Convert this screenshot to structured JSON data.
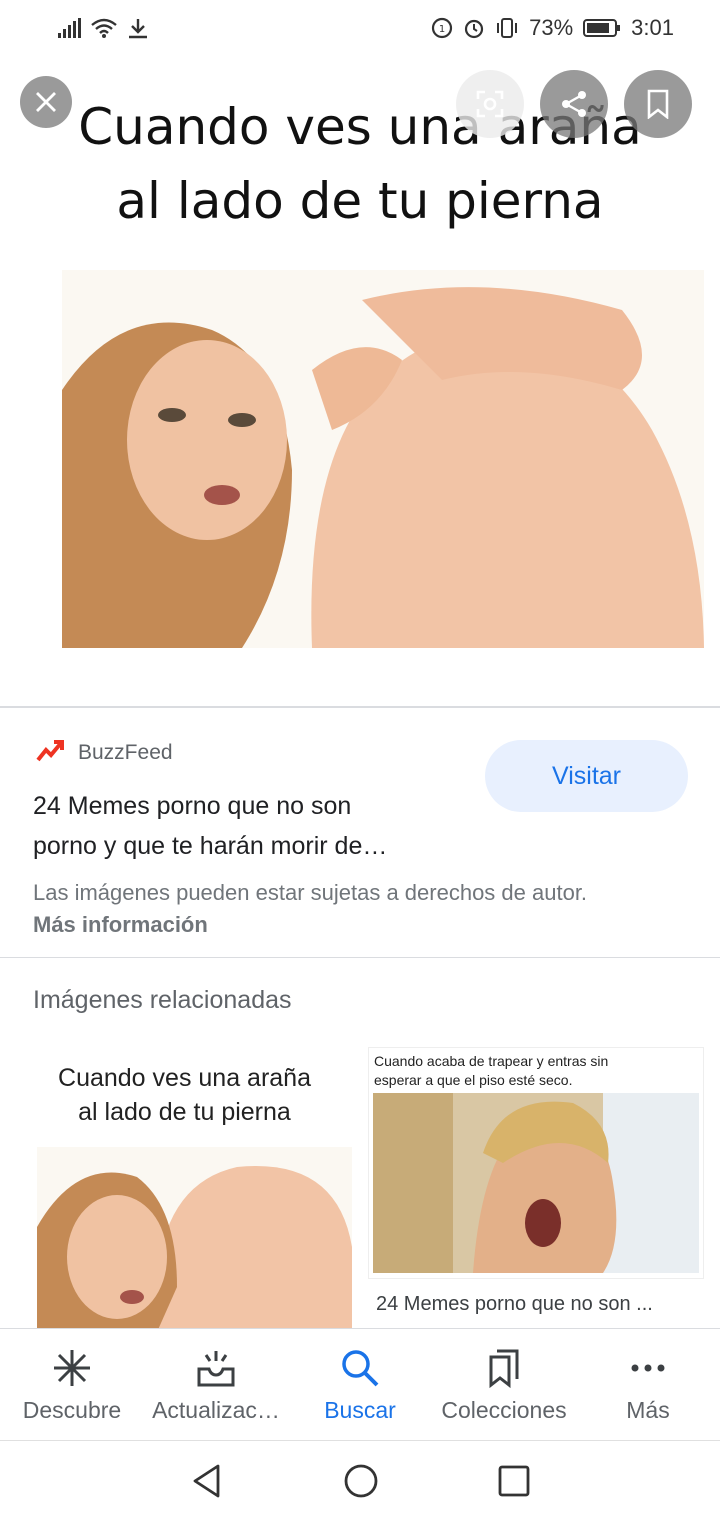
{
  "status_bar": {
    "battery": "73%",
    "time": "3:01"
  },
  "viewer": {
    "meme_caption_line1": "Cuando ves una araña",
    "meme_caption_line2": "al lado de tu pierna",
    "icons": [
      "close-icon",
      "lens-icon",
      "share-icon",
      "bookmark-icon"
    ]
  },
  "source": {
    "site": "BuzzFeed",
    "title_line1": "24 Memes porno que no son",
    "title_line2": "porno y que te harán morir de…",
    "visit_label": "Visitar",
    "copyright": "Las imágenes pueden estar sujetas a derechos de autor.",
    "more_info": "Más información"
  },
  "related": {
    "heading": "Imágenes relacionadas",
    "items": [
      {
        "caption_line1": "Cuando ves una araña",
        "caption_line2": "al lado de tu pierna"
      },
      {
        "caption_line1": "Cuando acaba de trapear y entras sin",
        "caption_line2": "esperar a que el piso esté seco.",
        "title": "24 Memes porno que no son ..."
      }
    ]
  },
  "bottom_nav": {
    "items": [
      {
        "label": "Descubre",
        "icon": "asterisk-icon"
      },
      {
        "label": "Actualizac…",
        "icon": "updates-tray-icon"
      },
      {
        "label": "Buscar",
        "icon": "search-icon"
      },
      {
        "label": "Colecciones",
        "icon": "collections-icon"
      },
      {
        "label": "Más",
        "icon": "more-dots-icon"
      }
    ],
    "active_index": 2
  },
  "colors": {
    "accent": "#1a73e8",
    "visit_bg": "#e8f0fe",
    "secondary_text": "#5f6368"
  }
}
